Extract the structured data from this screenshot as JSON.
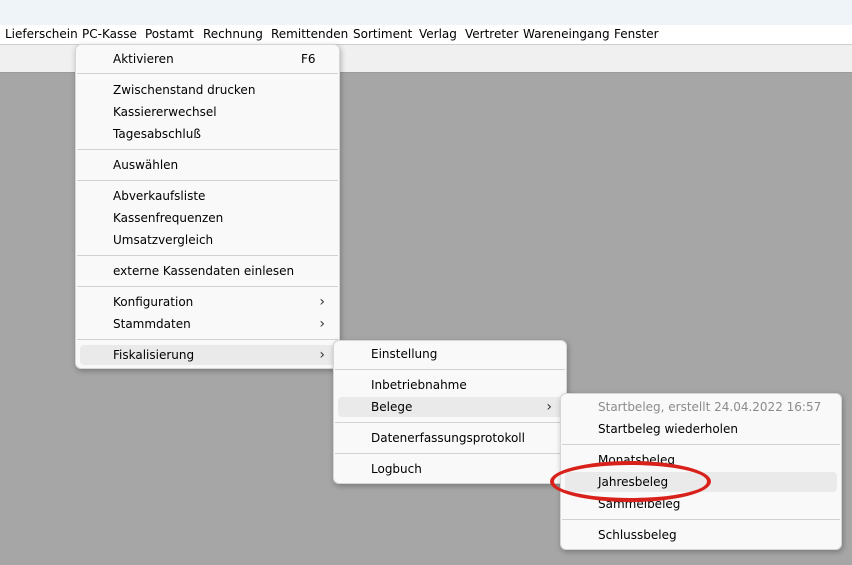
{
  "menubar": {
    "items": [
      "Lieferschein",
      "PC-Kasse",
      "Postamt",
      "Rechnung",
      "Remittenden",
      "Sortiment",
      "Verlag",
      "Vertreter",
      "Wareneingang",
      "Fenster"
    ]
  },
  "pc_kasse_menu": {
    "aktivieren": "Aktivieren",
    "aktivieren_shortcut": "F6",
    "zwischenstand": "Zwischenstand drucken",
    "kassiererwechsel": "Kassiererwechsel",
    "tagesabschluss": "Tagesabschluß",
    "auswaehlen": "Auswählen",
    "abverkaufsliste": "Abverkaufsliste",
    "kassenfrequenzen": "Kassenfrequenzen",
    "umsatzvergleich": "Umsatzvergleich",
    "externe_daten": "externe Kassendaten einlesen",
    "konfiguration": "Konfiguration",
    "stammdaten": "Stammdaten",
    "fiskalisierung": "Fiskalisierung"
  },
  "fiskalisierung_menu": {
    "einstellung": "Einstellung",
    "inbetriebnahme": "Inbetriebnahme",
    "belege": "Belege",
    "datenerfassungsprotokoll": "Datenerfassungsprotokoll",
    "logbuch": "Logbuch"
  },
  "belege_menu": {
    "startbeleg_erstellt": "Startbeleg, erstellt  24.04.2022 16:57",
    "startbeleg_wiederholen": "Startbeleg wiederholen",
    "monatsbeleg": "Monatsbeleg",
    "jahresbeleg": "Jahresbeleg",
    "sammelbeleg": "Sammelbeleg",
    "schlussbeleg": "Schlussbeleg"
  },
  "submenu_arrow": "›",
  "colors": {
    "annotation_red": "#d9211c",
    "workspace": "#a6a6a6",
    "highlight": "#eaeaea"
  }
}
